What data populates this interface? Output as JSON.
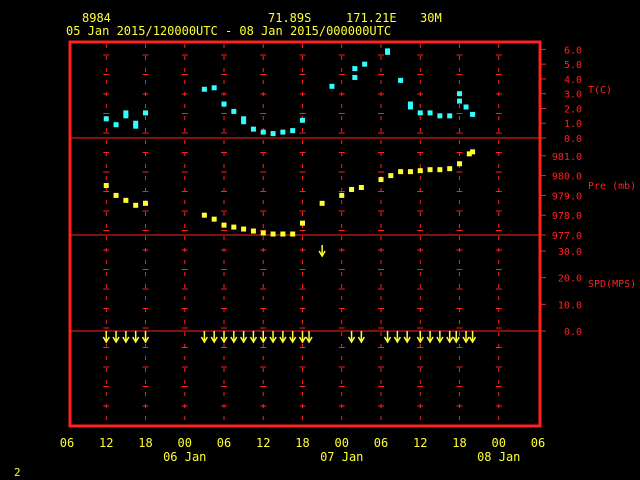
{
  "header": {
    "station_id": "8984",
    "latitude": "71.89S",
    "longitude": "171.21E",
    "elevation": "30M",
    "time_range": "05 Jan 2015/120000UTC - 08 Jan 2015/000000UTC"
  },
  "footer": {
    "page_number": "2"
  },
  "colors": {
    "frame": "#ff2020",
    "text": "#ffff33",
    "temperature": "#33ffff",
    "pressure": "#ffff33",
    "wind": "#ffff33"
  },
  "chart_data": {
    "type": "scatter",
    "x_axis": {
      "unit": "hours since 05 Jan 00UTC",
      "range": [
        6,
        78
      ],
      "tick_labels": [
        "06",
        "12",
        "18",
        "00",
        "06",
        "12",
        "18",
        "00",
        "06",
        "12",
        "18",
        "00",
        "06"
      ],
      "day_labels": [
        "06 Jan",
        "07 Jan",
        "08 Jan"
      ]
    },
    "panels": [
      {
        "name": "temperature",
        "ylabel": "T(C)",
        "ylim": [
          0,
          6.5
        ],
        "tick_labels": [
          "0.0",
          "1.0",
          "2.0",
          "3.0",
          "4.0",
          "5.0",
          "6.0"
        ],
        "points": [
          [
            12,
            1.3
          ],
          [
            13.5,
            0.9
          ],
          [
            15,
            1.7
          ],
          [
            15,
            1.5
          ],
          [
            16.5,
            1.0
          ],
          [
            16.5,
            0.8
          ],
          [
            18,
            1.7
          ],
          [
            27,
            3.3
          ],
          [
            28.5,
            3.4
          ],
          [
            30,
            2.3
          ],
          [
            31.5,
            1.8
          ],
          [
            33,
            1.3
          ],
          [
            33,
            1.1
          ],
          [
            34.5,
            0.6
          ],
          [
            36,
            0.4
          ],
          [
            37.5,
            0.3
          ],
          [
            39,
            0.4
          ],
          [
            40.5,
            0.5
          ],
          [
            42,
            1.2
          ],
          [
            46.5,
            3.5
          ],
          [
            50,
            4.1
          ],
          [
            50,
            4.7
          ],
          [
            51.5,
            5.0
          ],
          [
            55,
            5.8
          ],
          [
            55,
            5.9
          ],
          [
            57,
            3.9
          ],
          [
            58.5,
            2.3
          ],
          [
            58.5,
            2.1
          ],
          [
            60,
            1.7
          ],
          [
            61.5,
            1.7
          ],
          [
            63,
            1.5
          ],
          [
            64.5,
            1.5
          ],
          [
            66,
            3.0
          ],
          [
            66,
            2.5
          ],
          [
            67,
            2.1
          ],
          [
            68,
            1.6
          ]
        ]
      },
      {
        "name": "pressure",
        "ylabel": "Pre (mb)",
        "ylim": [
          977.0,
          981.9
        ],
        "tick_labels": [
          "977.0",
          "978.0",
          "979.0",
          "980.0",
          "981.0"
        ],
        "points": [
          [
            12,
            979.5
          ],
          [
            13.5,
            979.0
          ],
          [
            15,
            978.75
          ],
          [
            16.5,
            978.5
          ],
          [
            18,
            978.6
          ],
          [
            27,
            978.0
          ],
          [
            28.5,
            977.8
          ],
          [
            30,
            977.5
          ],
          [
            31.5,
            977.4
          ],
          [
            33,
            977.3
          ],
          [
            34.5,
            977.2
          ],
          [
            36,
            977.1
          ],
          [
            37.5,
            977.05
          ],
          [
            39,
            977.05
          ],
          [
            40.5,
            977.05
          ],
          [
            42,
            977.6
          ],
          [
            45,
            978.6
          ],
          [
            48,
            979.0
          ],
          [
            49.5,
            979.3
          ],
          [
            51,
            979.4
          ],
          [
            54,
            979.8
          ],
          [
            55.5,
            980.0
          ],
          [
            57,
            980.2
          ],
          [
            58.5,
            980.2
          ],
          [
            60,
            980.25
          ],
          [
            61.5,
            980.3
          ],
          [
            63,
            980.3
          ],
          [
            64.5,
            980.35
          ],
          [
            66,
            980.6
          ],
          [
            67.5,
            981.1
          ],
          [
            68,
            981.2
          ]
        ]
      },
      {
        "name": "wind",
        "ylabel": "SPD(MPS)",
        "ylim": [
          0,
          36
        ],
        "tick_labels": [
          "0.0",
          "10.0",
          "20.0",
          "30.0"
        ],
        "arrows_at_baseline": [
          12,
          13.5,
          15,
          16.5,
          18,
          27,
          28.5,
          30,
          31.5,
          33,
          34.5,
          36,
          37.5,
          39,
          40.5,
          42,
          43,
          49.5,
          51,
          55,
          56.5,
          58,
          60,
          61.5,
          63,
          64.5,
          65.5,
          67,
          68
        ],
        "elevated_arrow": {
          "x": 45,
          "speed": 30
        }
      }
    ]
  }
}
